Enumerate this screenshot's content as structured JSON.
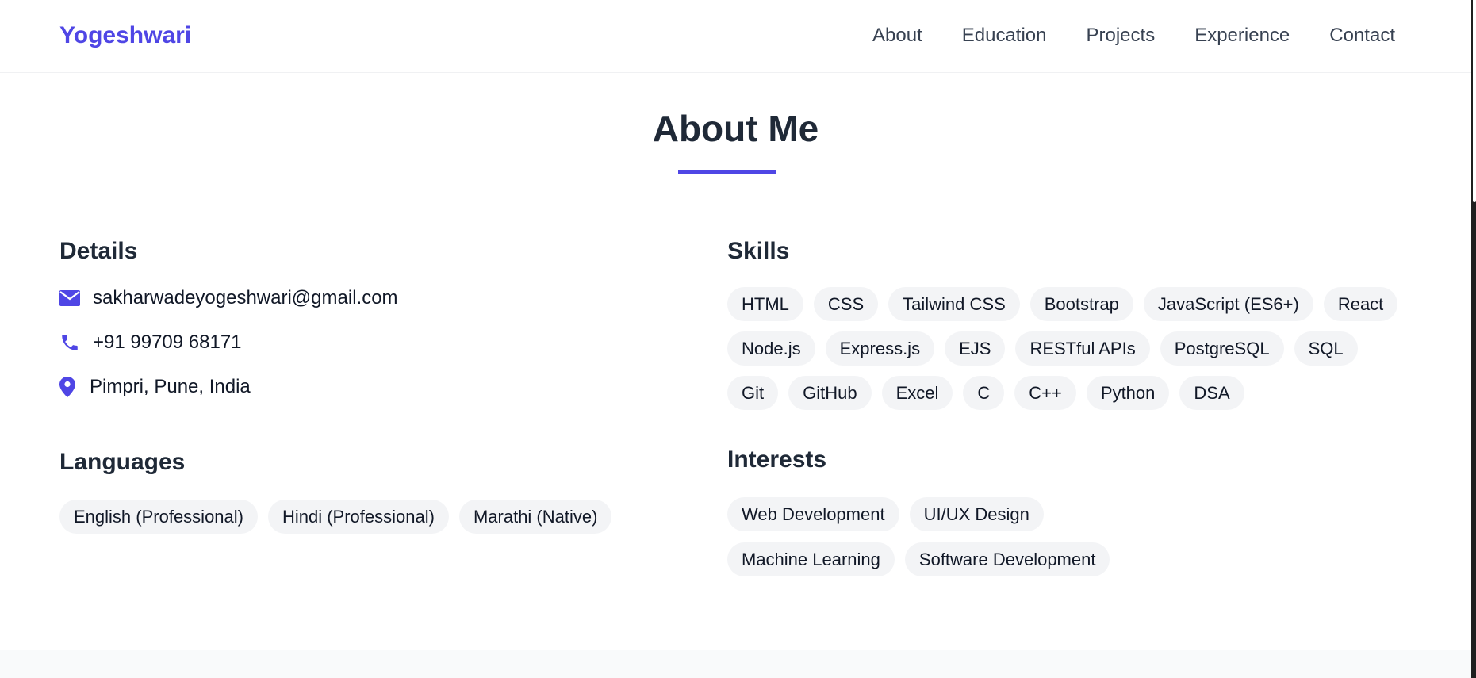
{
  "nav": {
    "brand": "Yogeshwari",
    "links": [
      "About",
      "Education",
      "Projects",
      "Experience",
      "Contact"
    ]
  },
  "about": {
    "title": "About Me",
    "details": {
      "heading": "Details",
      "email": "sakharwadeyogeshwari@gmail.com",
      "phone": "+91 99709 68171",
      "location": "Pimpri, Pune, India"
    },
    "languages": {
      "heading": "Languages",
      "items": [
        "English (Professional)",
        "Hindi (Professional)",
        "Marathi (Native)"
      ]
    },
    "skills": {
      "heading": "Skills",
      "items": [
        "HTML",
        "CSS",
        "Tailwind CSS",
        "Bootstrap",
        "JavaScript (ES6+)",
        "React",
        "Node.js",
        "Express.js",
        "EJS",
        "RESTful APIs",
        "PostgreSQL",
        "SQL",
        "Git",
        "GitHub",
        "Excel",
        "C",
        "C++",
        "Python",
        "DSA"
      ]
    },
    "interests": {
      "heading": "Interests",
      "items": [
        "Web Development",
        "UI/UX Design",
        "Machine Learning",
        "Software Development"
      ]
    }
  },
  "colors": {
    "accent": "#4f46e5",
    "text": "#1f2937",
    "pill_bg": "#f3f4f6"
  },
  "icons": {
    "email": "envelope-icon",
    "phone": "phone-icon",
    "location": "map-pin-icon"
  }
}
